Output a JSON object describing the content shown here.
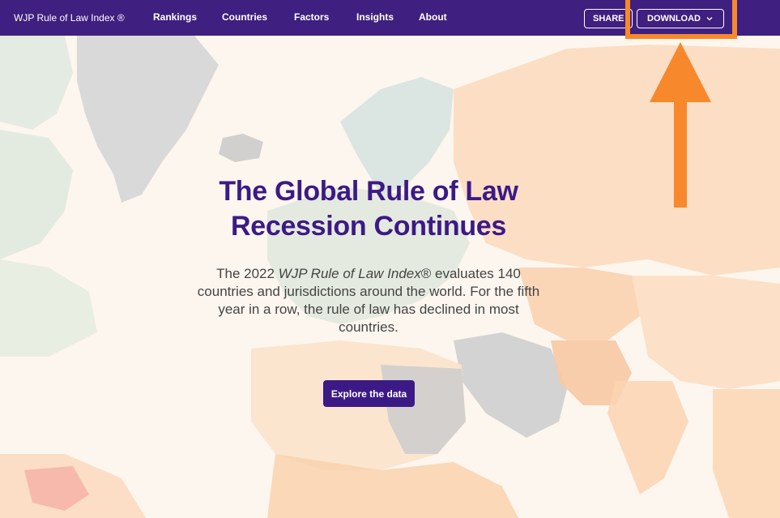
{
  "brand": "WJP Rule of Law Index ®",
  "nav": {
    "items": [
      {
        "label": "Rankings"
      },
      {
        "label": "Countries"
      },
      {
        "label": "Factors"
      },
      {
        "label": "Insights"
      },
      {
        "label": "About"
      }
    ],
    "share_label": "SHARE",
    "download_label": "DOWNLOAD"
  },
  "hero": {
    "title_line1": "The Global Rule of Law",
    "title_line2": "Recession Continues",
    "text_before": "The 2022 ",
    "text_italic": "WJP Rule of Law Index",
    "text_after": "® evaluates 140 countries and jurisdictions around the world. For the fifth year in a row, the rule of law has declined in most countries.",
    "cta_label": "Explore the data"
  },
  "colors": {
    "nav_bg": "#3f1f7f",
    "title": "#3c1a86",
    "highlight": "#f7882b",
    "map_gray": "#c8c8c8",
    "map_orange": "#fbd9b8",
    "map_green": "#cfe1cf"
  },
  "icons": {
    "dropdown": "chevron-down-icon",
    "annotation": "up-arrow-icon"
  }
}
